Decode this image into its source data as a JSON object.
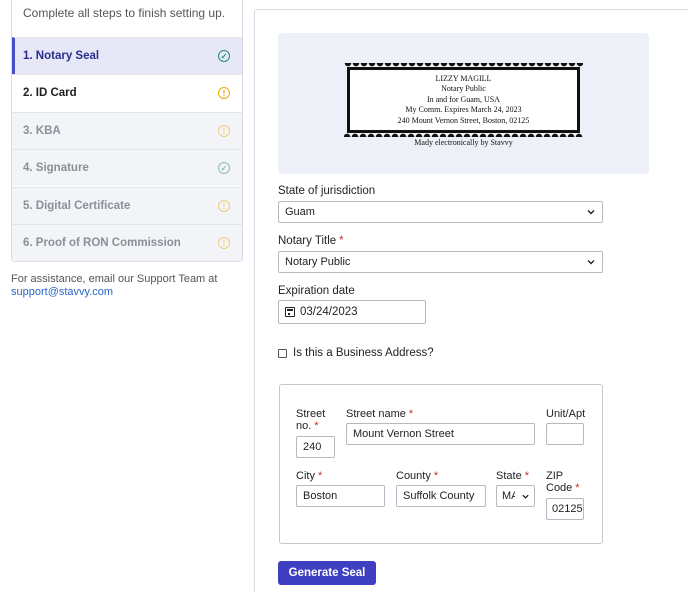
{
  "steps_intro": "Complete all steps to finish setting up.",
  "steps": [
    {
      "label": "1. Notary Seal",
      "status": "done",
      "state": "active"
    },
    {
      "label": "2. ID Card",
      "status": "pending",
      "state": "current"
    },
    {
      "label": "3. KBA",
      "status": "pending",
      "state": "faded"
    },
    {
      "label": "4. Signature",
      "status": "done",
      "state": "faded"
    },
    {
      "label": "5. Digital Certificate",
      "status": "pending",
      "state": "faded"
    },
    {
      "label": "6. Proof of RON Commission",
      "status": "pending",
      "state": "faded"
    }
  ],
  "support": {
    "text": "For assistance, email our Support Team at",
    "email": "support@stavvy.com"
  },
  "seal": {
    "lines": [
      "LIZZY MAGILL",
      "Notary Public",
      "In and for Guam, USA",
      "My Comm. Expires March 24, 2023",
      "240 Mount Vernon Street, Boston, 02125"
    ],
    "caption": "Mady electronically by Stavvy"
  },
  "form": {
    "jurisdiction": {
      "label": "State of jurisdiction",
      "value": "Guam"
    },
    "notary_title": {
      "label": "Notary Title",
      "required": "*",
      "value": "Notary Public"
    },
    "expiration": {
      "label": "Expiration date",
      "value": "03/24/2023"
    },
    "business_address": {
      "label": "Is this a Business Address?",
      "checked": false
    },
    "address": {
      "street_no": {
        "label": "Street no.",
        "required": "*",
        "value": "240"
      },
      "street_name": {
        "label": "Street name",
        "required": "*",
        "value": "Mount Vernon Street"
      },
      "unit": {
        "label": "Unit/Apt",
        "value": ""
      },
      "city": {
        "label": "City",
        "required": "*",
        "value": "Boston"
      },
      "county": {
        "label": "County",
        "required": "*",
        "value": "Suffolk County"
      },
      "state": {
        "label": "State",
        "required": "*",
        "value": "MA"
      },
      "zip": {
        "label": "ZIP Code",
        "required": "*",
        "value": "02125"
      }
    },
    "submit_label": "Generate Seal"
  },
  "colors": {
    "accent": "#3f3fc2",
    "done": "#2a8a79",
    "pending": "#f0a500",
    "required": "#c9302c",
    "link": "#2866c9"
  }
}
